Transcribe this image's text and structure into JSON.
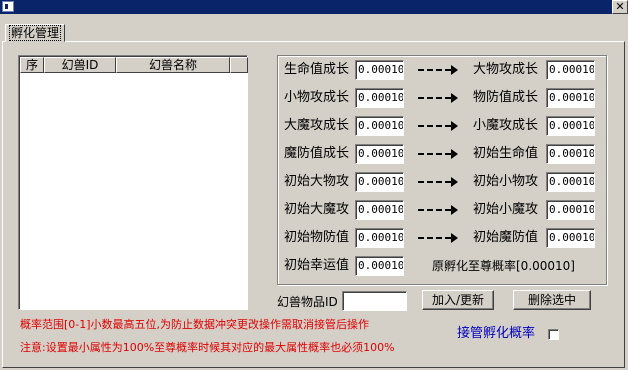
{
  "tab": {
    "label": "孵化管理"
  },
  "list": {
    "columns": [
      "序",
      "幻兽ID",
      "幻兽名称"
    ]
  },
  "rates": {
    "rows": [
      {
        "left_label": "生命值成长",
        "left_value": "0.00010",
        "right_label": "大物攻成长",
        "right_value": "0.00010"
      },
      {
        "left_label": "小物攻成长",
        "left_value": "0.00010",
        "right_label": "物防值成长",
        "right_value": "0.00010"
      },
      {
        "left_label": "大魔攻成长",
        "left_value": "0.00010",
        "right_label": "小魔攻成长",
        "right_value": "0.00010"
      },
      {
        "left_label": "魔防值成长",
        "left_value": "0.00010",
        "right_label": "初始生命值",
        "right_value": "0.00010"
      },
      {
        "left_label": "初始大物攻",
        "left_value": "0.00010",
        "right_label": "初始小物攻",
        "right_value": "0.00010"
      },
      {
        "left_label": "初始大魔攻",
        "left_value": "0.00010",
        "right_label": "初始小魔攻",
        "right_value": "0.00010"
      },
      {
        "left_label": "初始物防值",
        "left_value": "0.00010",
        "right_label": "初始魔防值",
        "right_value": "0.00010"
      }
    ],
    "luck_label": "初始幸运值",
    "luck_value": "0.00010",
    "original_label": "原孵化至尊概率[0.00010]"
  },
  "item_id": {
    "label": "幻兽物品ID",
    "value": ""
  },
  "buttons": {
    "add_update": "加入/更新",
    "delete_selected": "删除选中"
  },
  "notes": {
    "range": "概率范围[0-1]小数最高五位,为防止数据冲突更改操作需取消接管后操作",
    "attention": "注意:设置最小属性为100%至尊概率时候其对应的最大属性概率也必须100%"
  },
  "takeover": {
    "label": "接管孵化概率",
    "checked": false
  },
  "colors": {
    "title_bar": "#0a246a",
    "note_red": "#e00000",
    "takeover_blue": "#0000c0"
  }
}
